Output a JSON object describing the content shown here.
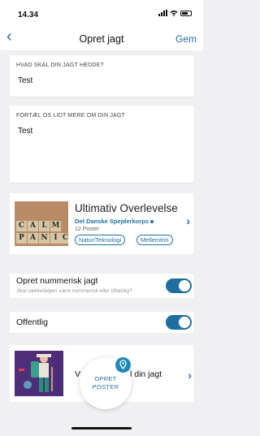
{
  "status": {
    "time": "14.34",
    "signal": "signal-icon",
    "wifi": "wifi-icon",
    "battery": "battery-icon"
  },
  "nav": {
    "back_icon": "chevron-left-icon",
    "title": "Opret jagt",
    "save": "Gem"
  },
  "name_field": {
    "label": "HVAD SKAL DIN JAGT HEDDE?",
    "value": "Test"
  },
  "desc_field": {
    "label": "FORTÆL OS LIDT MERE OM DIN JAGT",
    "value": "Test"
  },
  "jagt_card": {
    "image_letters": [
      "C",
      "A",
      "L",
      "M",
      "P",
      "A",
      "N",
      "I",
      "C"
    ],
    "title": "Ultimativ Overlevelse",
    "org": "Det Danske Spejderkorps",
    "count": "12 Poster",
    "tags": [
      "Natur/Teknologi",
      "Mellemtrin"
    ]
  },
  "numeric_toggle": {
    "label": "Opret nummerisk jagt",
    "sub": "Skal rækkefølgen være nummerisk eller tilfældig?",
    "on": true
  },
  "public_toggle": {
    "label": "Offentlig",
    "on": true
  },
  "adventure_card": {
    "prefix": "V",
    "suffix": "l din jagt"
  },
  "fab": {
    "line1": "OPRET",
    "line2": "POSTER"
  },
  "colors": {
    "accent": "#1f6f9e",
    "background": "#f0f0f2",
    "card": "#ffffff"
  }
}
